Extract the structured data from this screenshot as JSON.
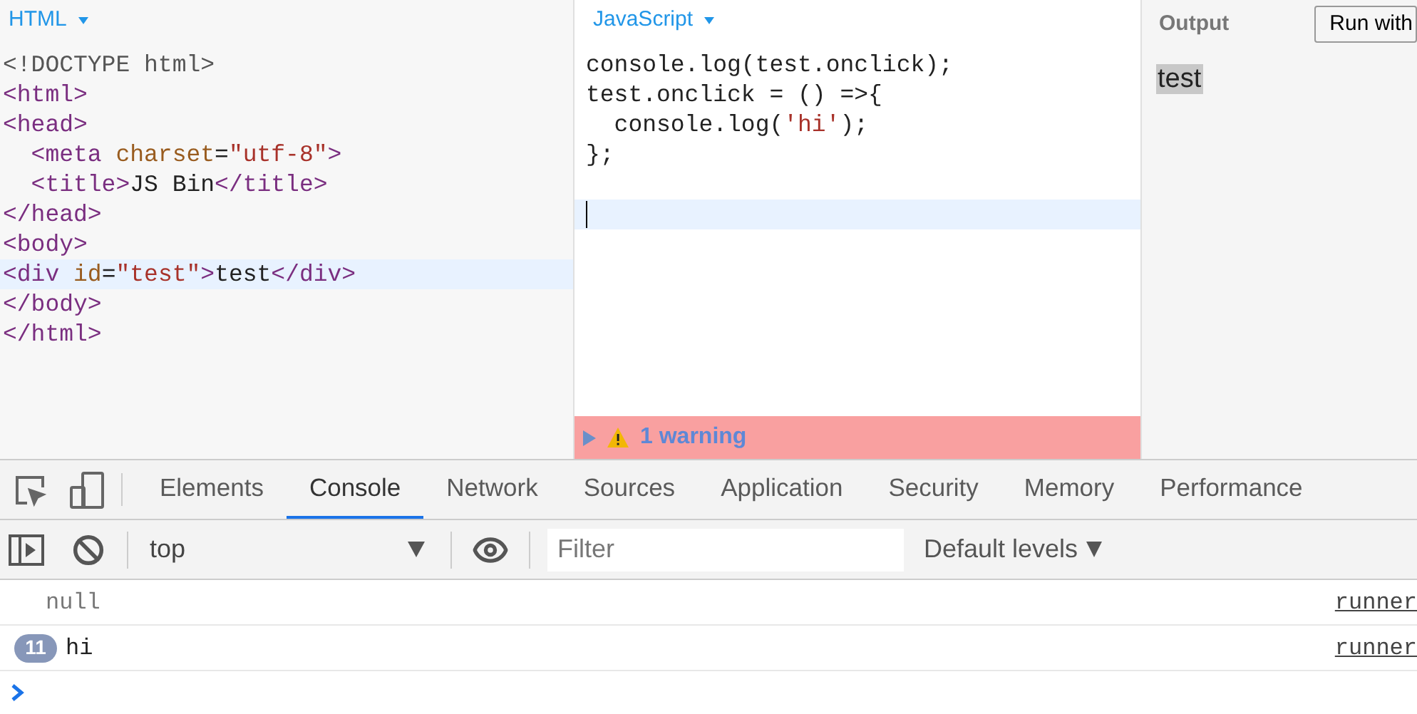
{
  "html_panel": {
    "title": "HTML",
    "lines": [
      {
        "active": false,
        "tokens": [
          {
            "text": "<!DOCTYPE html>",
            "kind": "meta"
          }
        ]
      },
      {
        "active": false,
        "tokens": [
          {
            "text": "<html>",
            "kind": "tag"
          }
        ]
      },
      {
        "active": false,
        "tokens": [
          {
            "text": "<head>",
            "kind": "tag"
          }
        ]
      },
      {
        "active": false,
        "tokens": [
          {
            "text": "  <meta",
            "kind": "tag"
          },
          {
            "text": " charset",
            "kind": "attr"
          },
          {
            "text": "=",
            "kind": "text"
          },
          {
            "text": "\"utf-8\"",
            "kind": "string"
          },
          {
            "text": ">",
            "kind": "tag"
          }
        ]
      },
      {
        "active": false,
        "tokens": [
          {
            "text": "  <title>",
            "kind": "tag"
          },
          {
            "text": "JS Bin",
            "kind": "text"
          },
          {
            "text": "</title>",
            "kind": "tag"
          }
        ]
      },
      {
        "active": false,
        "tokens": [
          {
            "text": "</head>",
            "kind": "tag"
          }
        ]
      },
      {
        "active": false,
        "tokens": [
          {
            "text": "<body>",
            "kind": "tag"
          }
        ]
      },
      {
        "active": true,
        "tokens": [
          {
            "text": "<div",
            "kind": "tag"
          },
          {
            "text": " id",
            "kind": "attr"
          },
          {
            "text": "=",
            "kind": "text"
          },
          {
            "text": "\"test\"",
            "kind": "string"
          },
          {
            "text": ">",
            "kind": "tag"
          },
          {
            "text": "test",
            "kind": "text"
          },
          {
            "text": "</div>",
            "kind": "tag"
          }
        ]
      },
      {
        "active": false,
        "tokens": [
          {
            "text": "</body>",
            "kind": "tag"
          }
        ]
      },
      {
        "active": false,
        "tokens": [
          {
            "text": "</html>",
            "kind": "tag"
          }
        ]
      }
    ]
  },
  "js_panel": {
    "title": "JavaScript",
    "lines": [
      {
        "active": false,
        "tokens": [
          {
            "text": "console.log(test.onclick);",
            "kind": "text"
          }
        ]
      },
      {
        "active": false,
        "tokens": [
          {
            "text": "test.onclick = () =>{",
            "kind": "text"
          }
        ]
      },
      {
        "active": false,
        "tokens": [
          {
            "text": "  console.log(",
            "kind": "text"
          },
          {
            "text": "'hi'",
            "kind": "string"
          },
          {
            "text": ");",
            "kind": "text"
          }
        ]
      },
      {
        "active": false,
        "tokens": [
          {
            "text": "};",
            "kind": "text"
          }
        ]
      },
      {
        "active": true
      }
    ],
    "warning": "1 warning"
  },
  "output_panel": {
    "title": "Output",
    "run_button": "Run with",
    "content": "test"
  },
  "devtools": {
    "tabs": [
      {
        "label": "Elements",
        "selected": false
      },
      {
        "label": "Console",
        "selected": true
      },
      {
        "label": "Network",
        "selected": false
      },
      {
        "label": "Sources",
        "selected": false
      },
      {
        "label": "Application",
        "selected": false
      },
      {
        "label": "Security",
        "selected": false
      },
      {
        "label": "Memory",
        "selected": false
      },
      {
        "label": "Performance",
        "selected": false
      }
    ],
    "context": "top",
    "filter_placeholder": "Filter",
    "levels": "Default levels",
    "messages": [
      {
        "kind": "value",
        "text": "null",
        "source": "runner"
      },
      {
        "kind": "log",
        "count": "11",
        "text": "hi",
        "source": "runner"
      }
    ]
  }
}
